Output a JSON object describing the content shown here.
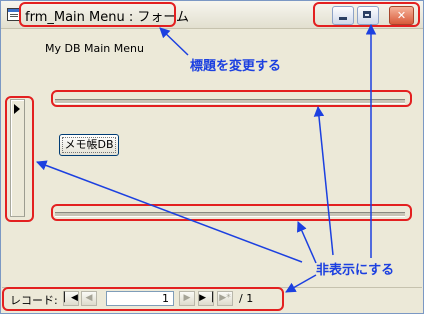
{
  "window": {
    "title": "frm_Main Menu : フォーム"
  },
  "form": {
    "caption": "My DB Main Menu",
    "memo_button_label": "メモ帳DB"
  },
  "navigation": {
    "label": "レコード:",
    "current_record": "1",
    "of_total": "/ 1",
    "buttons": {
      "first": "▏◀",
      "prev": "◀",
      "next": "▶",
      "last": "▶▕",
      "new": "▶*"
    }
  },
  "annotations": {
    "change_title": "標題を変更する",
    "hide": "非表示にする"
  },
  "colors": {
    "highlight": "#e32020",
    "annotation": "#1c40e0"
  }
}
